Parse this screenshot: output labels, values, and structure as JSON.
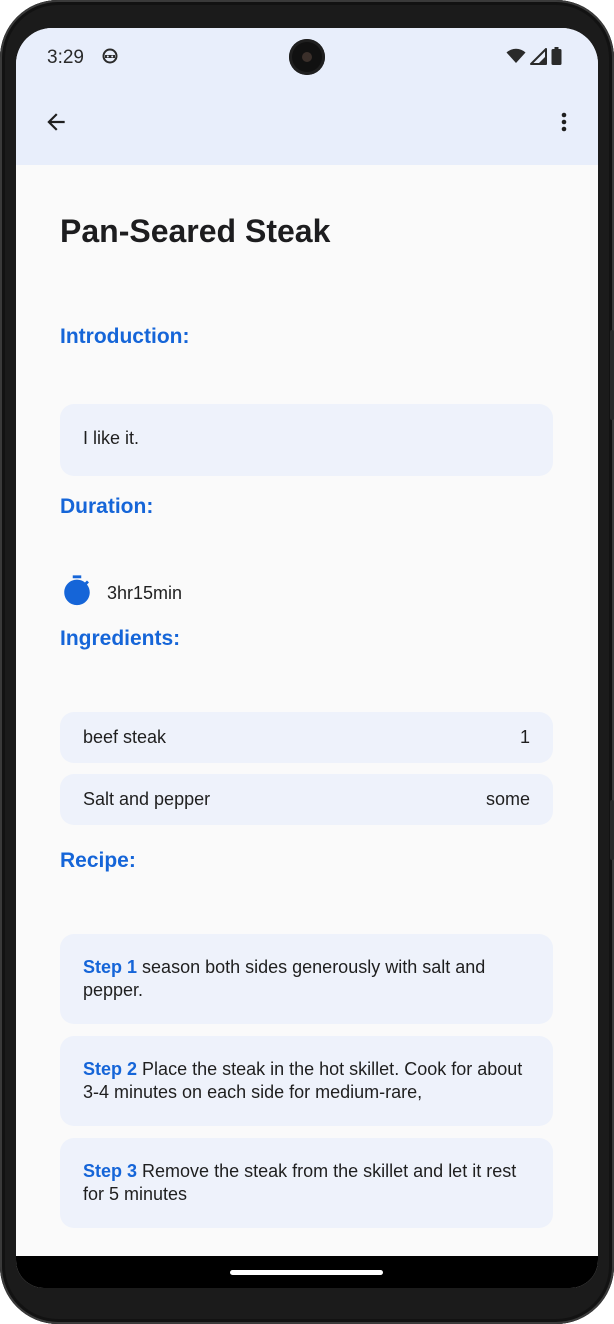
{
  "status_bar": {
    "time": "3:29",
    "app_icon": "android-robot-icon",
    "icons": [
      "wifi-icon",
      "signal-icon",
      "battery-icon"
    ]
  },
  "app_bar": {
    "back_icon": "arrow-back-icon",
    "menu_icon": "more-vert-icon"
  },
  "recipe": {
    "title": "Pan-Seared Steak",
    "introduction_heading": "Introduction:",
    "introduction_text": "I like it.",
    "duration_heading": "Duration:",
    "duration_icon": "timer-icon",
    "duration_value": "3hr15min",
    "ingredients_heading": "Ingredients:",
    "ingredients": [
      {
        "name": "beef steak",
        "amount": "1"
      },
      {
        "name": "Salt and pepper",
        "amount": "some"
      }
    ],
    "recipe_heading": "Recipe:",
    "steps": [
      {
        "label": "Step 1",
        "text": "season both sides generously with salt and pepper."
      },
      {
        "label": "Step 2",
        "text": "Place the steak in the hot skillet. Cook for about 3-4 minutes on each side for medium-rare,"
      },
      {
        "label": "Step 3",
        "text": "Remove the steak from the skillet and let it rest for 5 minutes"
      }
    ]
  },
  "colors": {
    "accent": "#1565d8",
    "app_bar_bg": "#e8eefb",
    "card_bg": "#eef2fb",
    "page_bg": "#fafafa"
  }
}
